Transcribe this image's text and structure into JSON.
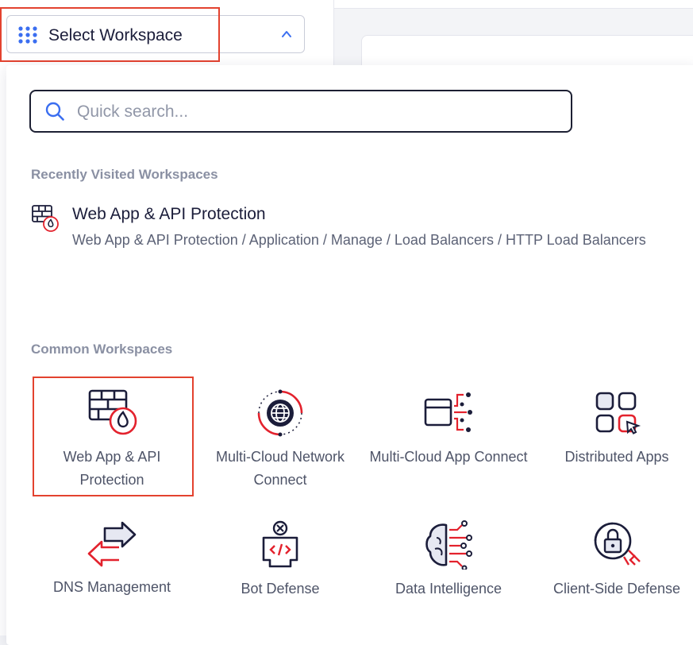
{
  "selector": {
    "label": "Select Workspace"
  },
  "search": {
    "placeholder": "Quick search..."
  },
  "recent": {
    "title": "Recently Visited Workspaces",
    "items": [
      {
        "title": "Web App & API Protection",
        "path": "Web App & API Protection / Application / Manage / Load Balancers / HTTP Load Balancers",
        "icon": "firewall-flame-icon"
      }
    ]
  },
  "common": {
    "title": "Common Workspaces",
    "tiles": [
      {
        "label": "Web App & API Protection",
        "icon": "firewall-flame-icon"
      },
      {
        "label": "Multi-Cloud Network Connect",
        "icon": "globe-network-icon"
      },
      {
        "label": "Multi-Cloud App Connect",
        "icon": "app-connect-icon"
      },
      {
        "label": "Distributed Apps",
        "icon": "app-grid-cursor-icon"
      },
      {
        "label": "DNS Management",
        "icon": "swap-arrows-icon"
      },
      {
        "label": "Bot Defense",
        "icon": "bot-code-icon"
      },
      {
        "label": "Data Intelligence",
        "icon": "brain-circuit-icon"
      },
      {
        "label": "Client-Side Defense",
        "icon": "lock-shield-icon"
      }
    ]
  },
  "colors": {
    "accent": "#e3222d",
    "navy": "#1b1d3a",
    "highlight": "#e3422f",
    "primary": "#3b6ef0"
  }
}
